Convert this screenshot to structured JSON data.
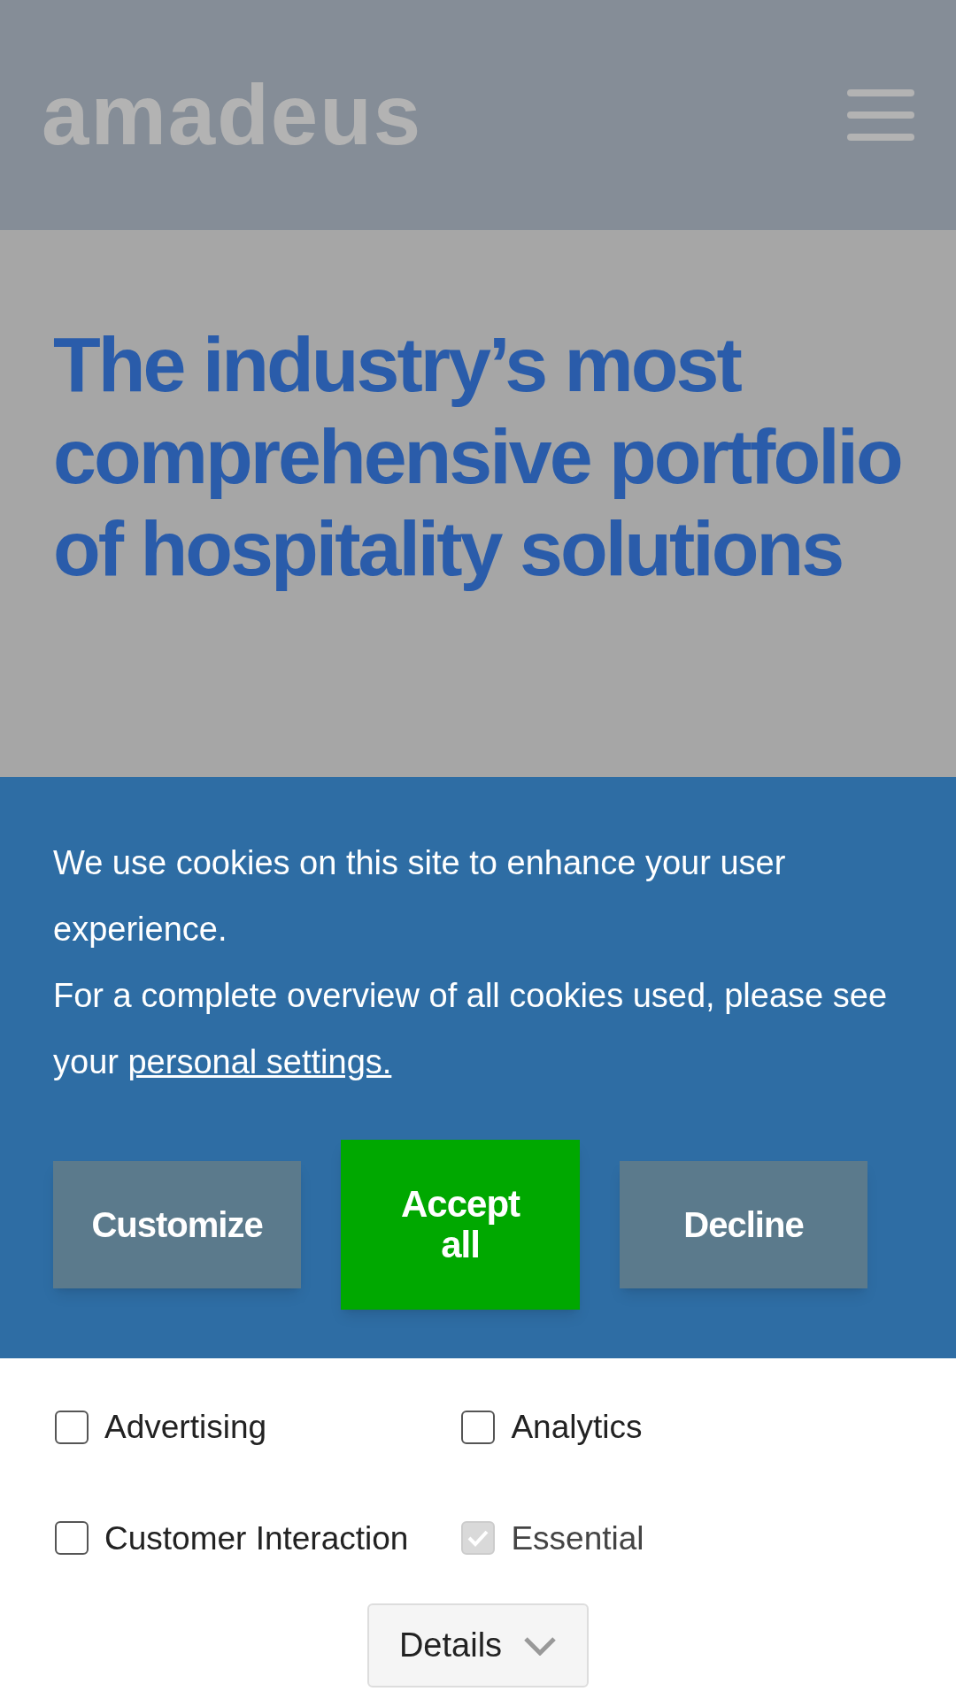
{
  "header": {
    "logo": "amadeus"
  },
  "hero": {
    "title": "The industry’s most comprehensive portfolio of hospitality solutions"
  },
  "cookie_banner": {
    "message": "We use cookies on this site to enhance your user experience.",
    "overview_text": "For a complete overview of all cookies used, please see your",
    "link": "personal settings.",
    "buttons": [
      {
        "label": "Customize",
        "kind": "secondary"
      },
      {
        "label": "Accept all",
        "kind": "primary"
      },
      {
        "label": "Decline",
        "kind": "secondary"
      }
    ]
  },
  "categories": [
    {
      "label": "Advertising",
      "checked": false,
      "disabled": false
    },
    {
      "label": "Analytics",
      "checked": false,
      "disabled": false
    },
    {
      "label": "Customer Interaction",
      "checked": false,
      "disabled": false
    },
    {
      "label": "Essential",
      "checked": true,
      "disabled": true
    }
  ],
  "details_button": {
    "label": "Details"
  }
}
